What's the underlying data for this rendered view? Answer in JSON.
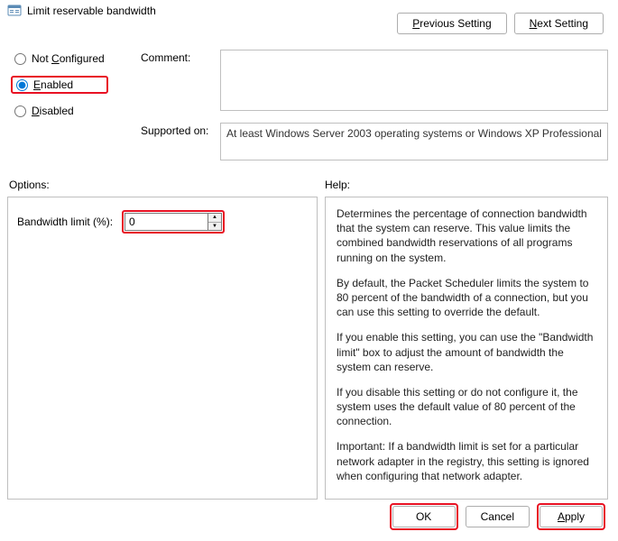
{
  "title": "Limit reservable bandwidth",
  "nav": {
    "prev": "Previous Setting",
    "next": "Next Setting"
  },
  "state_options": {
    "not_configured": "Not Configured",
    "enabled": "Enabled",
    "disabled": "Disabled",
    "selected": "enabled"
  },
  "comment": {
    "label": "Comment:",
    "value": ""
  },
  "supported": {
    "label": "Supported on:",
    "text": "At least Windows Server 2003 operating systems or Windows XP Professional"
  },
  "sections": {
    "options": "Options:",
    "help": "Help:"
  },
  "options_panel": {
    "bandwidth_label": "Bandwidth limit (%):",
    "bandwidth_value": "0"
  },
  "help_text": {
    "p1": "Determines the percentage of connection bandwidth that the system can reserve. This value limits the combined bandwidth reservations of all programs running on the system.",
    "p2": "By default, the Packet Scheduler limits the system to 80 percent of the bandwidth of a connection, but you can use this setting to override the default.",
    "p3": "If you enable this setting, you can use the \"Bandwidth limit\" box to adjust the amount of bandwidth the system can reserve.",
    "p4": "If you disable this setting or do not configure it, the system uses the default value of 80 percent of the connection.",
    "p5": "Important: If a bandwidth limit is set for a particular network adapter in the registry, this setting is ignored when configuring that network adapter."
  },
  "buttons": {
    "ok": "OK",
    "cancel": "Cancel",
    "apply": "Apply"
  }
}
